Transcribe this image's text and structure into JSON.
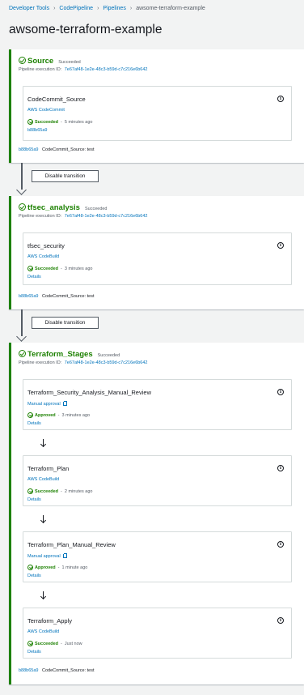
{
  "breadcrumb": {
    "items": [
      "Developer Tools",
      "CodePipeline",
      "Pipelines"
    ],
    "current": "awsome-terraform-example"
  },
  "page": {
    "title": "awsome-terraform-example"
  },
  "stages": [
    {
      "name": "Source",
      "status": "Succeeded",
      "exec_label": "Pipeline execution ID:",
      "exec_id": "7e67af48-1e2e-48c3-b59d-c7c216e6b642",
      "actions": [
        {
          "name": "CodeCommit_Source",
          "provider": "AWS CodeCommit",
          "status": "Succeeded",
          "time": "5 minutes ago",
          "detail": "b88b65a9"
        }
      ],
      "footer_commit": "b88b65a9",
      "footer_msg": "CodeCommit_Source: test"
    },
    {
      "name": "tfsec_analysis",
      "status": "Succeeded",
      "exec_label": "Pipeline execution ID:",
      "exec_id": "7e67af48-1e2e-48c3-b59d-c7c216e6b642",
      "actions": [
        {
          "name": "tfsec_security",
          "provider": "AWS CodeBuild",
          "status": "Succeeded",
          "time": "3 minutes ago",
          "detail": "Details"
        }
      ],
      "footer_commit": "b88b65a9",
      "footer_msg": "CodeCommit_Source: test"
    },
    {
      "name": "Terraform_Stages",
      "status": "Succeeded",
      "exec_label": "Pipeline execution ID:",
      "exec_id": "7e67af48-1e2e-48c3-b59d-c7c216e6b642",
      "actions": [
        {
          "name": "Terraform_Security_Analysis_Manual_Review",
          "provider": "Manual approval",
          "status": "Approved",
          "time": "3 minutes ago",
          "detail": "Details"
        },
        {
          "name": "Terraform_Plan",
          "provider": "AWS CodeBuild",
          "status": "Succeeded",
          "time": "2 minutes ago",
          "detail": "Details"
        },
        {
          "name": "Terraform_Plan_Manual_Review",
          "provider": "Manual approval",
          "status": "Approved",
          "time": "1 minute ago",
          "detail": "Details"
        },
        {
          "name": "Terraform_Apply",
          "provider": "AWS CodeBuild",
          "status": "Succeeded",
          "time": "Just now",
          "detail": "Details"
        }
      ],
      "footer_commit": "b88b65a9",
      "footer_msg": "CodeCommit_Source: test"
    }
  ],
  "transitions": [
    {
      "button_label": "Disable transition"
    },
    {
      "button_label": "Disable transition"
    }
  ],
  "icons": {
    "status_ok": "check-circle-icon",
    "info": "info-icon",
    "external": "external-link-icon",
    "breadcrumb_separator": "chevron-right-icon"
  },
  "colors": {
    "success": "#1d8102",
    "link": "#0073bb",
    "background": "#f2f3f3"
  }
}
